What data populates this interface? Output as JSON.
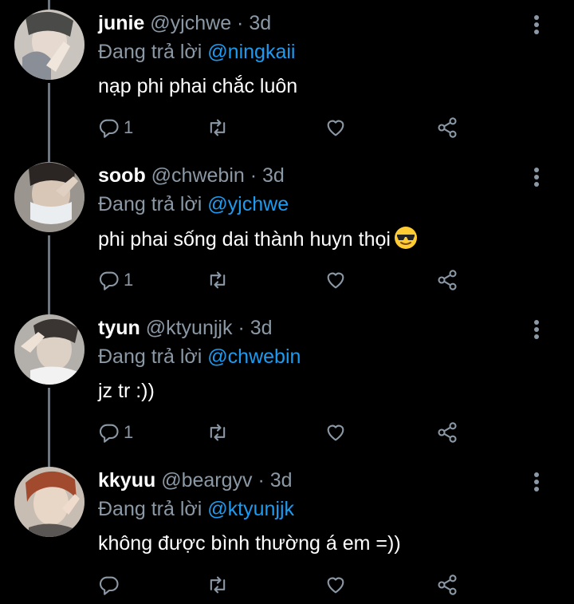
{
  "tweets": [
    {
      "name": "junie",
      "handle": "@yjchwe",
      "dot": "·",
      "time": "3d",
      "reply_prefix": "Đang trả lời",
      "reply_mention": "@ningkaii",
      "text": "nạp phi phai chắc luôn",
      "reply_count": "1",
      "emoji": ""
    },
    {
      "name": "soob",
      "handle": "@chwebin",
      "dot": "·",
      "time": "3d",
      "reply_prefix": "Đang trả lời",
      "reply_mention": "@yjchwe",
      "text": "phi phai sống dai thành huyn thọi",
      "reply_count": "1",
      "emoji": "sunglasses-emoji"
    },
    {
      "name": "tyun",
      "handle": "@ktyunjjk",
      "dot": "·",
      "time": "3d",
      "reply_prefix": "Đang trả lời",
      "reply_mention": "@chwebin",
      "text": "jz tr :))",
      "reply_count": "1",
      "emoji": ""
    },
    {
      "name": "kkyuu",
      "handle": "@beargyv",
      "dot": "·",
      "time": "3d",
      "reply_prefix": "Đang trả lời",
      "reply_mention": "@ktyunjjk",
      "text": "không được bình thường á em =))",
      "reply_count": "",
      "emoji": ""
    }
  ],
  "colors": {
    "background": "#000000",
    "secondary_text": "#8b98a5",
    "mention": "#1d9bf0",
    "thread_line": "#6e767d"
  },
  "icons": {
    "reply": "reply-icon",
    "retweet": "retweet-icon",
    "like": "heart-icon",
    "share": "share-icon",
    "more": "more-vertical-icon"
  }
}
